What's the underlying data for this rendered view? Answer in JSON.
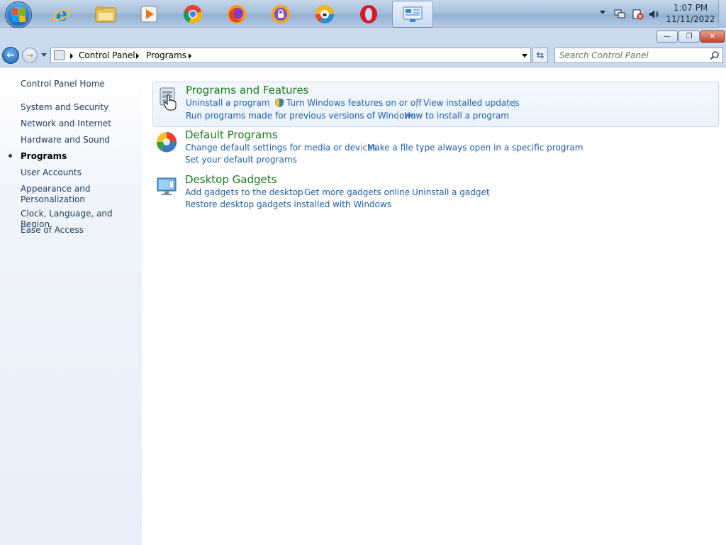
{
  "taskbar": {
    "apps": [
      {
        "name": "internet-explorer",
        "color": "#1e7fd8"
      },
      {
        "name": "file-explorer",
        "color": "#e2b64a"
      },
      {
        "name": "media-player",
        "color": "#e07a1c"
      },
      {
        "name": "chrome",
        "color": "#2e9c47"
      },
      {
        "name": "firefox",
        "color": "#e8641b"
      },
      {
        "name": "privacy-browser-1",
        "color": "#7a52c8"
      },
      {
        "name": "privacy-browser-2",
        "color": "#2a8ad8"
      },
      {
        "name": "opera",
        "color": "#d9192a"
      },
      {
        "name": "control-panel",
        "color": "#3b86c9"
      }
    ],
    "clock_time": "1:07 PM",
    "clock_date": "11/11/2022"
  },
  "window": {
    "minimize_glyph": "—",
    "restore_glyph": "❐",
    "close_glyph": "✕"
  },
  "address": {
    "crumbs": [
      "Control Panel",
      "Programs"
    ],
    "search_placeholder": "Search Control Panel"
  },
  "sidebar": {
    "home": "Control Panel Home",
    "items": [
      "System and Security",
      "Network and Internet",
      "Hardware and Sound",
      "Programs",
      "User Accounts",
      "Appearance and Personalization",
      "Clock, Language, and Region",
      "Ease of Access"
    ],
    "current_index": 3
  },
  "categories": {
    "programs_features": {
      "title": "Programs and Features",
      "links": [
        "Uninstall a program",
        "Turn Windows features on or off",
        "View installed updates",
        "Run programs made for previous versions of Windows",
        "How to install a program"
      ]
    },
    "default_programs": {
      "title": "Default Programs",
      "links": [
        "Change default settings for media or devices",
        "Make a file type always open in a specific program",
        "Set your default programs"
      ]
    },
    "desktop_gadgets": {
      "title": "Desktop Gadgets",
      "links": [
        "Add gadgets to the desktop",
        "Get more gadgets online",
        "Uninstall a gadget",
        "Restore desktop gadgets installed with Windows"
      ]
    }
  },
  "colors": {
    "link": "#1e5ea8",
    "category_title": "#1a7a1a",
    "sidebar_text": "#1e395b"
  }
}
